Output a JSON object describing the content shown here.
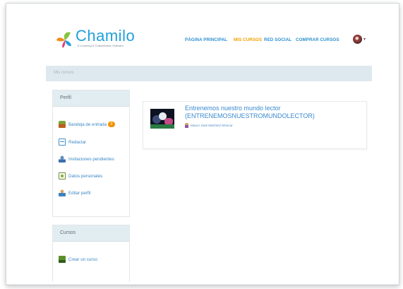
{
  "brand": {
    "name": "Chamilo",
    "tagline": "E-Learning & Collaboration Software"
  },
  "nav": {
    "items": [
      {
        "label": "PÁGINA PRINCIPAL",
        "active": false
      },
      {
        "label": "MIS CURSOS",
        "active": true
      },
      {
        "label": "RED SOCIAL",
        "active": false
      },
      {
        "label": "COMPRAR CURSOS",
        "active": false
      }
    ],
    "caret": "▾"
  },
  "breadcrumb": {
    "current": "Mis cursos"
  },
  "profile_block": {
    "title": "Perfil",
    "items": [
      {
        "label": "Bandeja de entrada",
        "icon": "inbox-icon",
        "badge": "0"
      },
      {
        "label": "Redactar",
        "icon": "compose-icon"
      },
      {
        "label": "Invitaciones pendientes",
        "icon": "invitations-icon"
      },
      {
        "label": "Datos personales",
        "icon": "personal-data-icon"
      },
      {
        "label": "Editar perfil",
        "icon": "edit-profile-icon"
      }
    ]
  },
  "courses_block": {
    "title": "Cursos",
    "items": [
      {
        "label": "Crear un curso",
        "icon": "create-course-icon"
      }
    ]
  },
  "course_card": {
    "title": "Entrenemos nuestro mundo lector (ENTRENEMOSNUESTROMUNDOLECTOR)",
    "teacher": "Mauro José Martínez Moncar"
  },
  "colors": {
    "accent": "#2c8fcf",
    "active_nav": "#f0a100",
    "brand": "#1fa0dc",
    "badge": "#f39200"
  }
}
